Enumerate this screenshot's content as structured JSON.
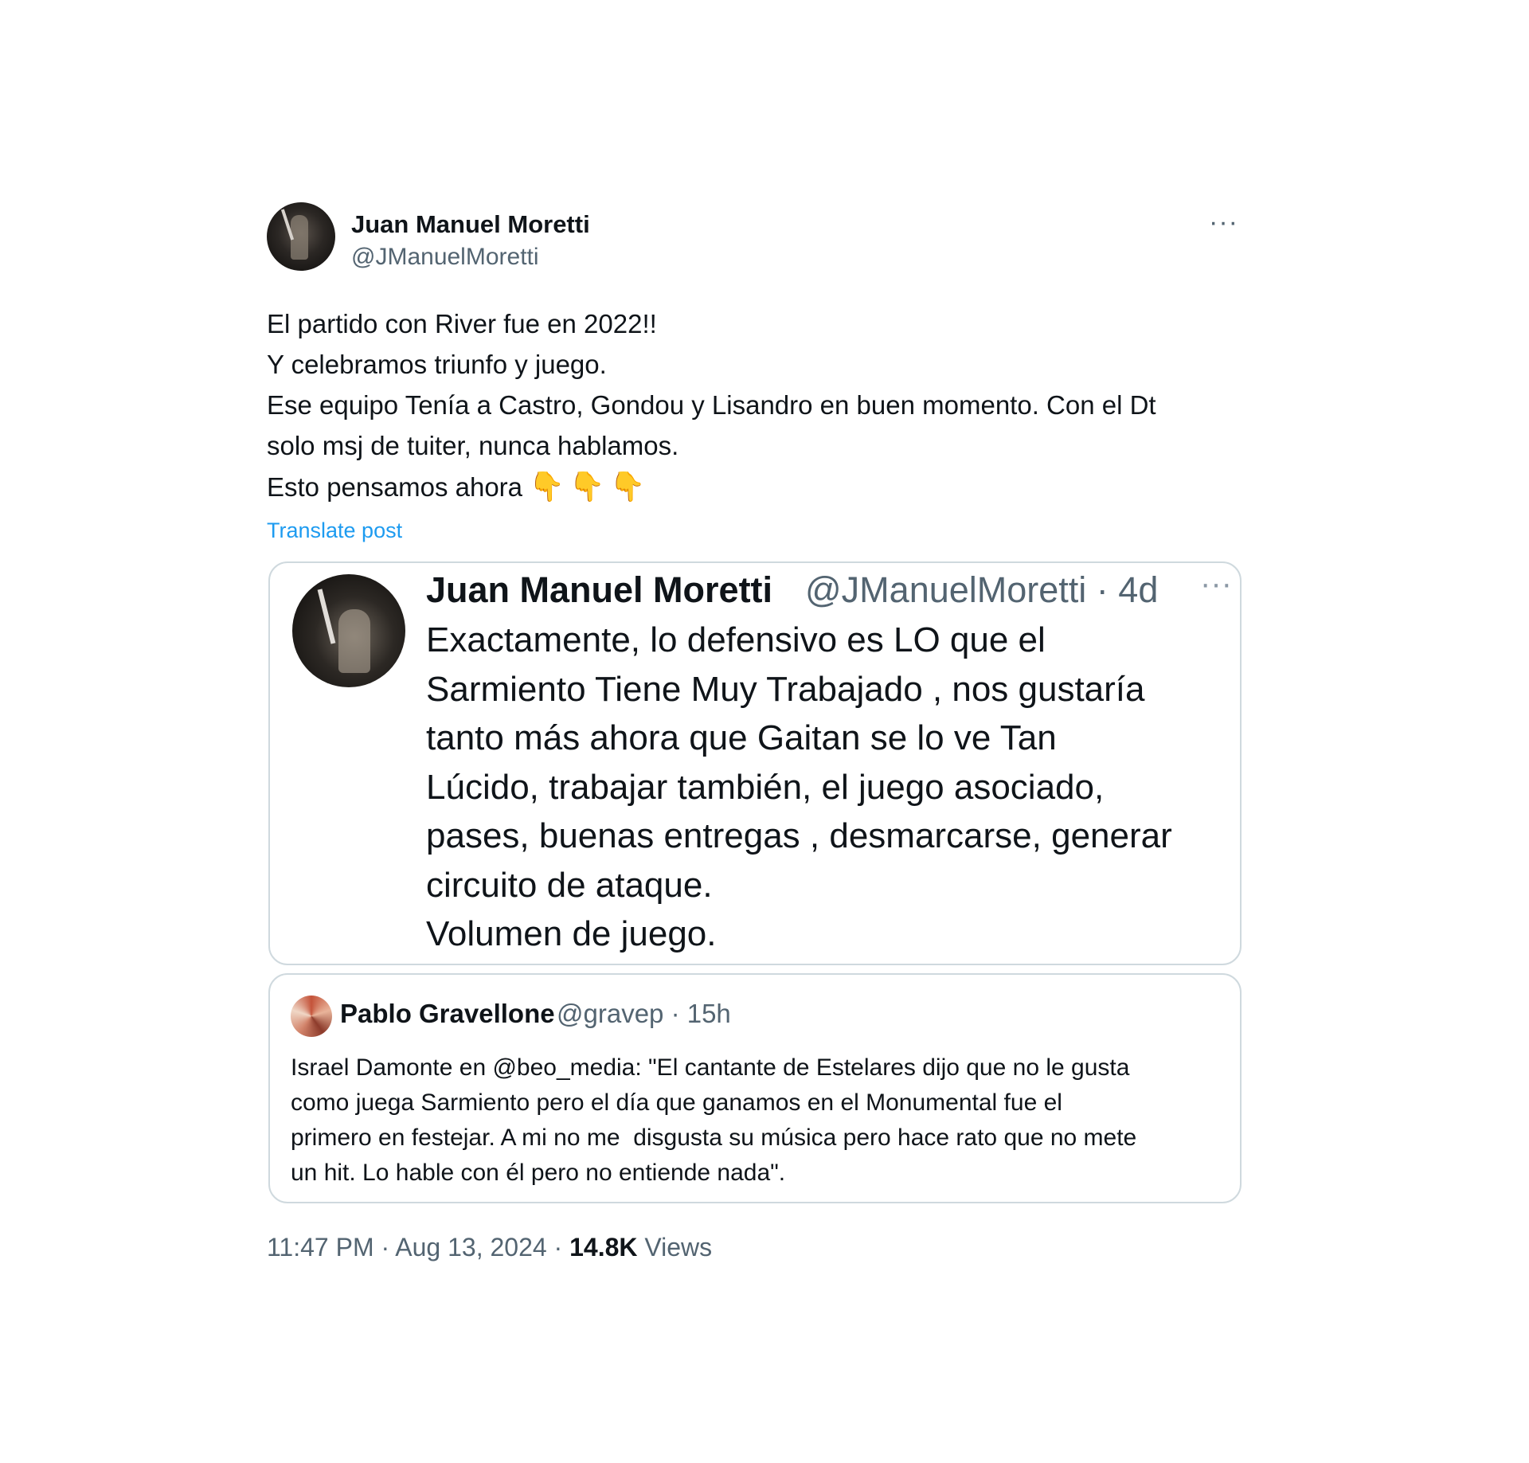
{
  "post": {
    "author_name": "Juan Manuel Moretti",
    "author_handle": "@JManuelMoretti",
    "more_label": "···",
    "text_lines": [
      "El partido con River fue en 2022!!",
      "Y celebramos triunfo y juego.",
      "Ese equipo Tenía a Castro, Gondou y Lisandro en buen momento. Con el Dt",
      "solo msj de tuiter, nunca hablamos.",
      "Esto pensamos ahora"
    ],
    "emoji": "👇👇👇",
    "translate_label": "Translate post",
    "time": "11:47 PM · Aug 13, 2024 · ",
    "views_count": "14.8K",
    "views_label": " Views"
  },
  "quoted_post": {
    "author_name": "Juan Manuel Moretti",
    "author_handle": "@JManuelMoretti · 4d",
    "more_label": "···",
    "text_lines": [
      "Exactamente, lo defensivo es LO que el",
      "Sarmiento Tiene Muy Trabajado , nos gustaría",
      "tanto más ahora que Gaitan se lo ve Tan",
      "Lúcido, trabajar también, el juego asociado,",
      "pases, buenas entregas , desmarcarse, generar",
      "circuito de ataque.",
      "Volumen de juego."
    ]
  },
  "nested_quote": {
    "author_name": "Pablo Gravellone",
    "author_handle": "@gravep · 15h",
    "text_lines": [
      "Israel Damonte en @beo_media: \"El cantante de Estelares dijo que no le gusta",
      "como juega Sarmiento pero el día que ganamos en el Monumental fue el",
      "primero en festejar. A mi no me  disgusta su música pero hace rato que no mete",
      "un hit. Lo hable con él pero no entiende nada\"."
    ]
  }
}
